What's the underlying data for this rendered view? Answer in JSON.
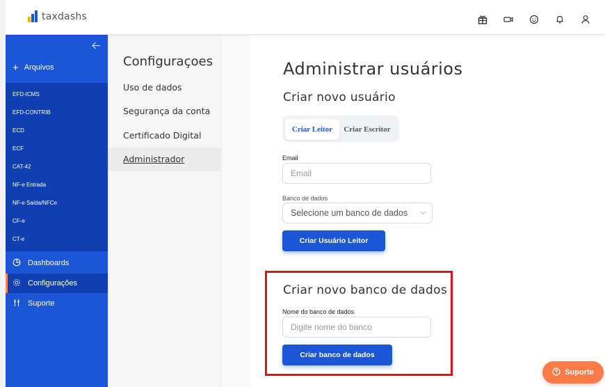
{
  "app": {
    "logo_text": "taxdashs"
  },
  "topbar": {
    "icons": [
      "gift-icon",
      "video-icon",
      "smile-icon",
      "bell-icon",
      "user-icon"
    ]
  },
  "sidebar": {
    "back_icon": "arrow-left-icon",
    "arquivos_label": "Arquivos",
    "sub_items": [
      "EFD-ICMS",
      "EFD-CONTRIB",
      "ECD",
      "ECF",
      "CAT-42",
      "NF-e Entrada",
      "NF-e Saída/NFCe",
      "CF-e",
      "CT-e"
    ],
    "main_items": [
      {
        "label": "Dashboards",
        "icon": "chart-pie-icon",
        "active": false
      },
      {
        "label": "Configurações",
        "icon": "gear-icon",
        "active": true
      },
      {
        "label": "Suporte",
        "icon": "support-icon",
        "active": false
      }
    ],
    "accent": "#1a56d6",
    "active_indicator": "#ff8a50"
  },
  "settings": {
    "title": "Configuraçoes",
    "items": [
      "Uso de dados",
      "Segurança da conta",
      "Certificado Digital",
      "Administrador"
    ],
    "active_index": 3
  },
  "main": {
    "title": "Administrar usuários",
    "create_user_title": "Criar novo usuário",
    "tabs": [
      {
        "label": "Criar Leitor",
        "active": true
      },
      {
        "label": "Criar Escritor",
        "active": false
      }
    ],
    "email_label": "Email",
    "email_placeholder": "Email",
    "db_label": "Banco de dados",
    "db_select_value": "Selecione um banco de dados",
    "create_reader_button": "Criar Usuário Leitor",
    "create_db_title": "Criar novo banco de dados",
    "db_name_label": "Nome do banco de dados",
    "db_name_placeholder": "Digite nome do banco",
    "create_db_button": "Criar banco de dados"
  },
  "support_button": {
    "label": "Suporte",
    "icon": "help-circle-icon",
    "color": "#ff7a47"
  },
  "highlight_color": "#e0121c"
}
